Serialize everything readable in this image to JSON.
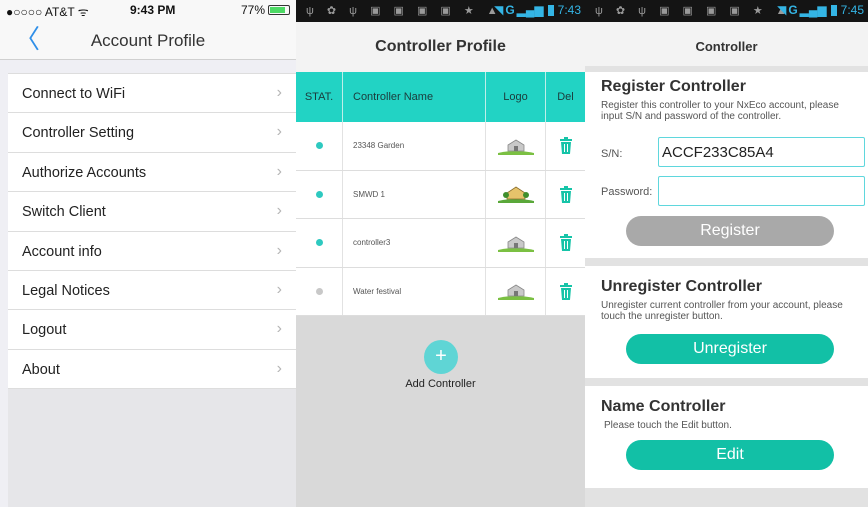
{
  "pane1": {
    "status": {
      "carrier": "●○○○○ AT&T ᯤ",
      "time": "9:43 PM",
      "battery": "77%"
    },
    "nav": {
      "back_glyph": "〈",
      "title": "Account Profile"
    },
    "menu": [
      {
        "label": "Connect to WiFi"
      },
      {
        "label": "Controller Setting"
      },
      {
        "label": "Authorize Accounts"
      },
      {
        "label": "Switch Client"
      },
      {
        "label": "Account info"
      },
      {
        "label": "Legal Notices"
      },
      {
        "label": "Logout"
      },
      {
        "label": "About"
      }
    ],
    "chevron": "›"
  },
  "android_status": {
    "left_icons": "ψ ✿ ψ ▣ ▣ ▣ ▣ ★ ▲",
    "network": "G",
    "bars": "▂▄▆",
    "time_pane2": "7:43",
    "time_pane3": "7:45"
  },
  "pane2": {
    "title": "Controller Profile",
    "headers": {
      "stat": "STAT.",
      "name": "Controller  Name",
      "logo": "Logo",
      "del": "Del"
    },
    "rows": [
      {
        "name": "23348 Garden",
        "online": true
      },
      {
        "name": "SMWD 1",
        "online": true
      },
      {
        "name": "controller3",
        "online": true
      },
      {
        "name": "Water festival",
        "online": false
      }
    ],
    "colors": {
      "online": "#2ec9c0",
      "offline": "#c8c8c8",
      "header_bg": "#22d3c4"
    },
    "add_button_glyph": "+",
    "add_label": "Add Controller"
  },
  "pane3": {
    "title": "Controller",
    "register": {
      "heading": "Register Controller",
      "desc": "Register this controller to your NxEco account, please input S/N and password of the controller.",
      "sn_label": "S/N:",
      "sn_value": "ACCF233C85A4",
      "password_label": "Password:",
      "password_value": "",
      "button": "Register"
    },
    "unregister": {
      "heading": "Unregister Controller",
      "desc": "Unregister current controller from your account, please touch the unregister button.",
      "button": "Unregister"
    },
    "name": {
      "heading": "Name Controller",
      "desc": "Please touch the Edit button.",
      "button": "Edit"
    }
  }
}
